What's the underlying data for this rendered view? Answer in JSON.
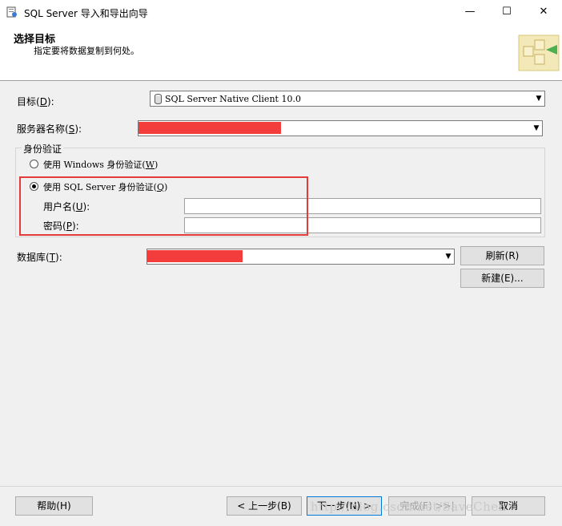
{
  "window": {
    "title": "SQL Server 导入和导出向导",
    "minimize": "—",
    "maximize": "☐",
    "close": "✕"
  },
  "header": {
    "title": "选择目标",
    "subtitle": "指定要将数据复制到何处。"
  },
  "destination": {
    "label": "目标(",
    "mnemonic": "D",
    "label_end": "):",
    "value": "SQL Server Native Client 10.0"
  },
  "server": {
    "label": "服务器名称(",
    "mnemonic": "S",
    "label_end": "):"
  },
  "auth": {
    "group_title": "身份验证",
    "windows_label": "使用 Windows 身份验证(",
    "windows_mnemonic": "W",
    "windows_end": ")",
    "sql_label": "使用 SQL Server 身份验证(",
    "sql_mnemonic": "Q",
    "sql_end": ")",
    "username_label": "用户名(",
    "username_mnemonic": "U",
    "username_end": "):",
    "password_label": "密码(",
    "password_mnemonic": "P",
    "password_end": "):",
    "selected": "sql"
  },
  "database": {
    "label": "数据库(",
    "mnemonic": "T",
    "label_end": "):",
    "refresh_label": "刷新(R)",
    "new_label": "新建(E)..."
  },
  "footer": {
    "help": "帮助(H)",
    "back": "< 上一步(B)",
    "next": "下一步(N) >",
    "finish": "完成(F) >>|",
    "cancel": "取消"
  },
  "watermark": "http://blog.csdn.net/SaveChen",
  "colors": {
    "redaction": "#f33d3d",
    "highlight_box": "#e23b3b"
  }
}
